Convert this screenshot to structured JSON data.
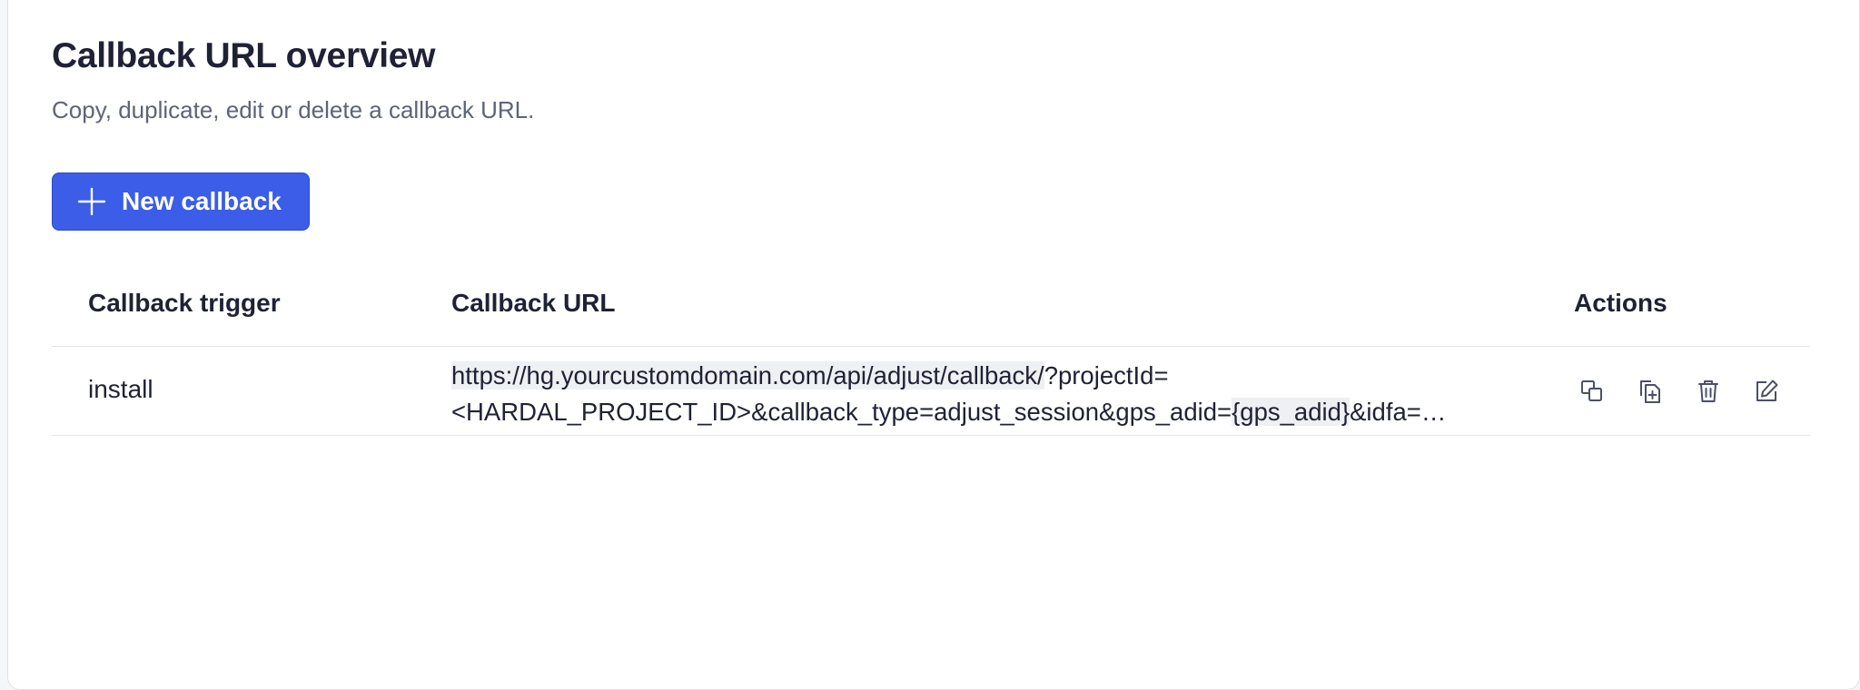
{
  "header": {
    "title": "Callback URL overview",
    "subtitle": "Copy, duplicate, edit or delete a callback URL."
  },
  "toolbar": {
    "new_callback_label": "New callback"
  },
  "table": {
    "columns": [
      "Callback trigger",
      "Callback URL",
      "Actions"
    ],
    "rows": [
      {
        "trigger": "install",
        "url_line1_highlight": "https://hg.yourcustomdomain.com/api/adjust/callback/",
        "url_line1_rest": "?projectId=",
        "url_line2_pre": "<HARDAL_PROJECT_ID>&callback_type=adjust_session&gps_adid=",
        "url_line2_highlight": "{gps_adid}",
        "url_line2_post": "&idfa=…",
        "actions": [
          "copy-icon",
          "duplicate-icon",
          "trash-icon",
          "edit-icon"
        ]
      }
    ]
  },
  "colors": {
    "accent": "#3b5de7",
    "text": "#1f2235",
    "muted": "#5e6478",
    "icon": "#4a5066"
  }
}
